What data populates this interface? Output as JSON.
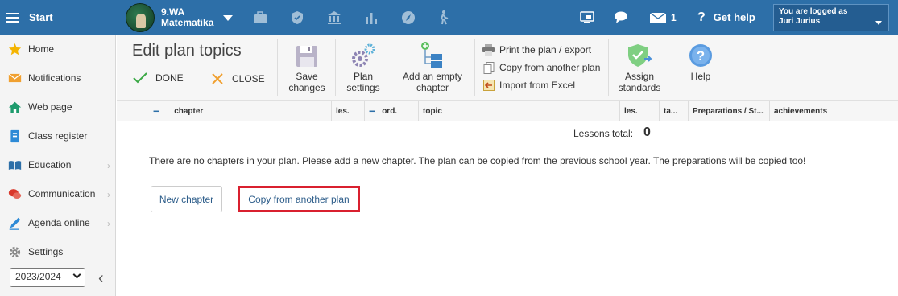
{
  "topbar": {
    "start_label": "Start",
    "class_name": "9.WA",
    "subject": "Matematika",
    "message_count": "1",
    "help_label": "Get help",
    "logged_in_label": "You are logged as",
    "user_name": "Juri Jurius",
    "colors": {
      "bar": "#2d6fa8"
    }
  },
  "sidebar": {
    "items": [
      {
        "label": "Home",
        "icon": "star-icon"
      },
      {
        "label": "Notifications",
        "icon": "envelope-icon"
      },
      {
        "label": "Web page",
        "icon": "house-icon"
      },
      {
        "label": "Class register",
        "icon": "register-icon"
      },
      {
        "label": "Education",
        "icon": "book-icon"
      },
      {
        "label": "Communication",
        "icon": "chat-icon"
      },
      {
        "label": "Agenda online",
        "icon": "pen-icon"
      },
      {
        "label": "Settings",
        "icon": "gear-icon"
      }
    ],
    "school_year": "2023/2024"
  },
  "ribbon": {
    "title": "Edit plan topics",
    "done_label": "DONE",
    "close_label": "CLOSE",
    "save_line1": "Save",
    "save_line2": "changes",
    "plan_line1": "Plan",
    "plan_line2": "settings",
    "add_line1": "Add an empty",
    "add_line2": "chapter",
    "print_label": "Print the plan / export",
    "copy_label": "Copy from another plan",
    "import_label": "Import from Excel",
    "assign_line1": "Assign",
    "assign_line2": "standards",
    "help_label": "Help"
  },
  "table": {
    "columns": [
      "chapter",
      "les.",
      "ord.",
      "topic",
      "les.",
      "ta...",
      "Preparations / St...",
      "achievements"
    ]
  },
  "main": {
    "lessons_total_label": "Lessons total:",
    "lessons_total_value": "0",
    "message": "There are no chapters in your plan. Please add a new chapter. The plan can be copied from the previous school year. The preparations will be copied too!",
    "new_chapter_label": "New chapter",
    "copy_plan_label": "Copy from another plan",
    "highlight_color": "#d9202f"
  }
}
